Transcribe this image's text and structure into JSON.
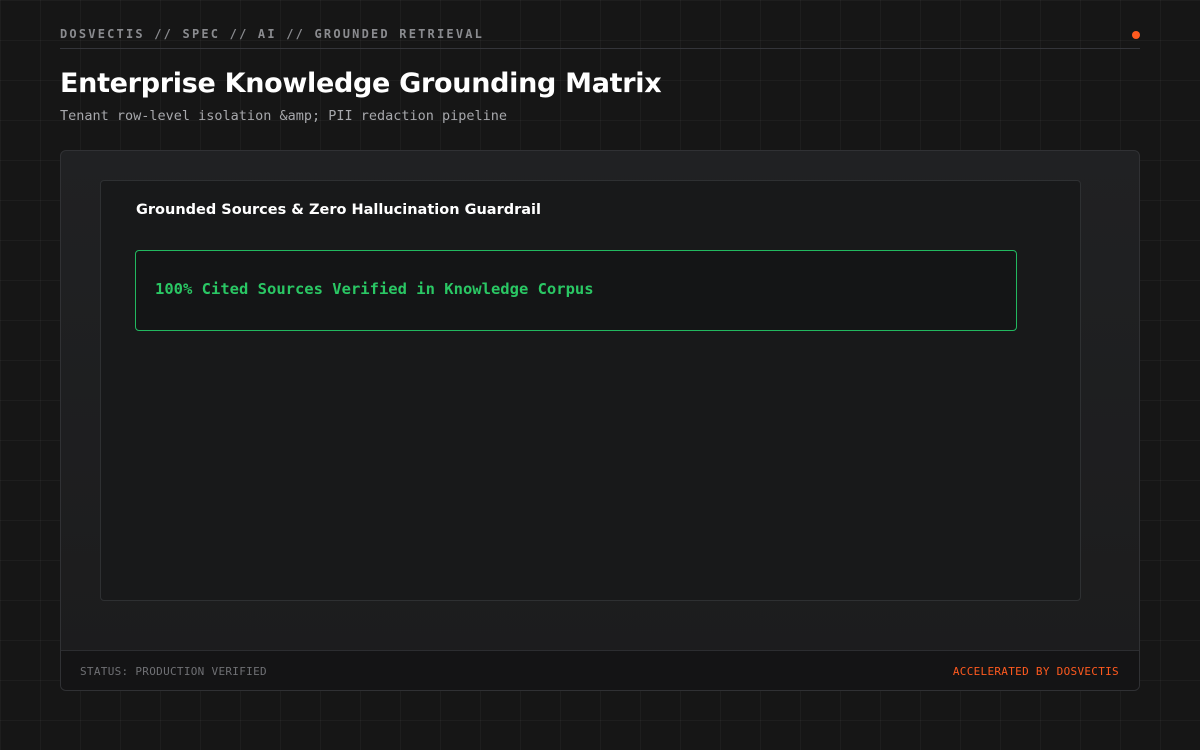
{
  "header": {
    "breadcrumb": "DOSVECTIS // SPEC // AI // GROUNDED RETRIEVAL",
    "title": "Enterprise Knowledge Grounding Matrix",
    "subtitle": "Tenant row-level isolation &amp; PII redaction pipeline",
    "status_dot_color": "#ff5a1f"
  },
  "card": {
    "title": "Grounded Sources & Zero Hallucination Guardrail",
    "verification_text": "100% Cited Sources Verified in Knowledge Corpus",
    "verification_color": "#2ac764"
  },
  "footer": {
    "status": "STATUS: PRODUCTION VERIFIED",
    "brand": "ACCELERATED BY DOSVECTIS",
    "brand_color": "#ff5a1f"
  }
}
